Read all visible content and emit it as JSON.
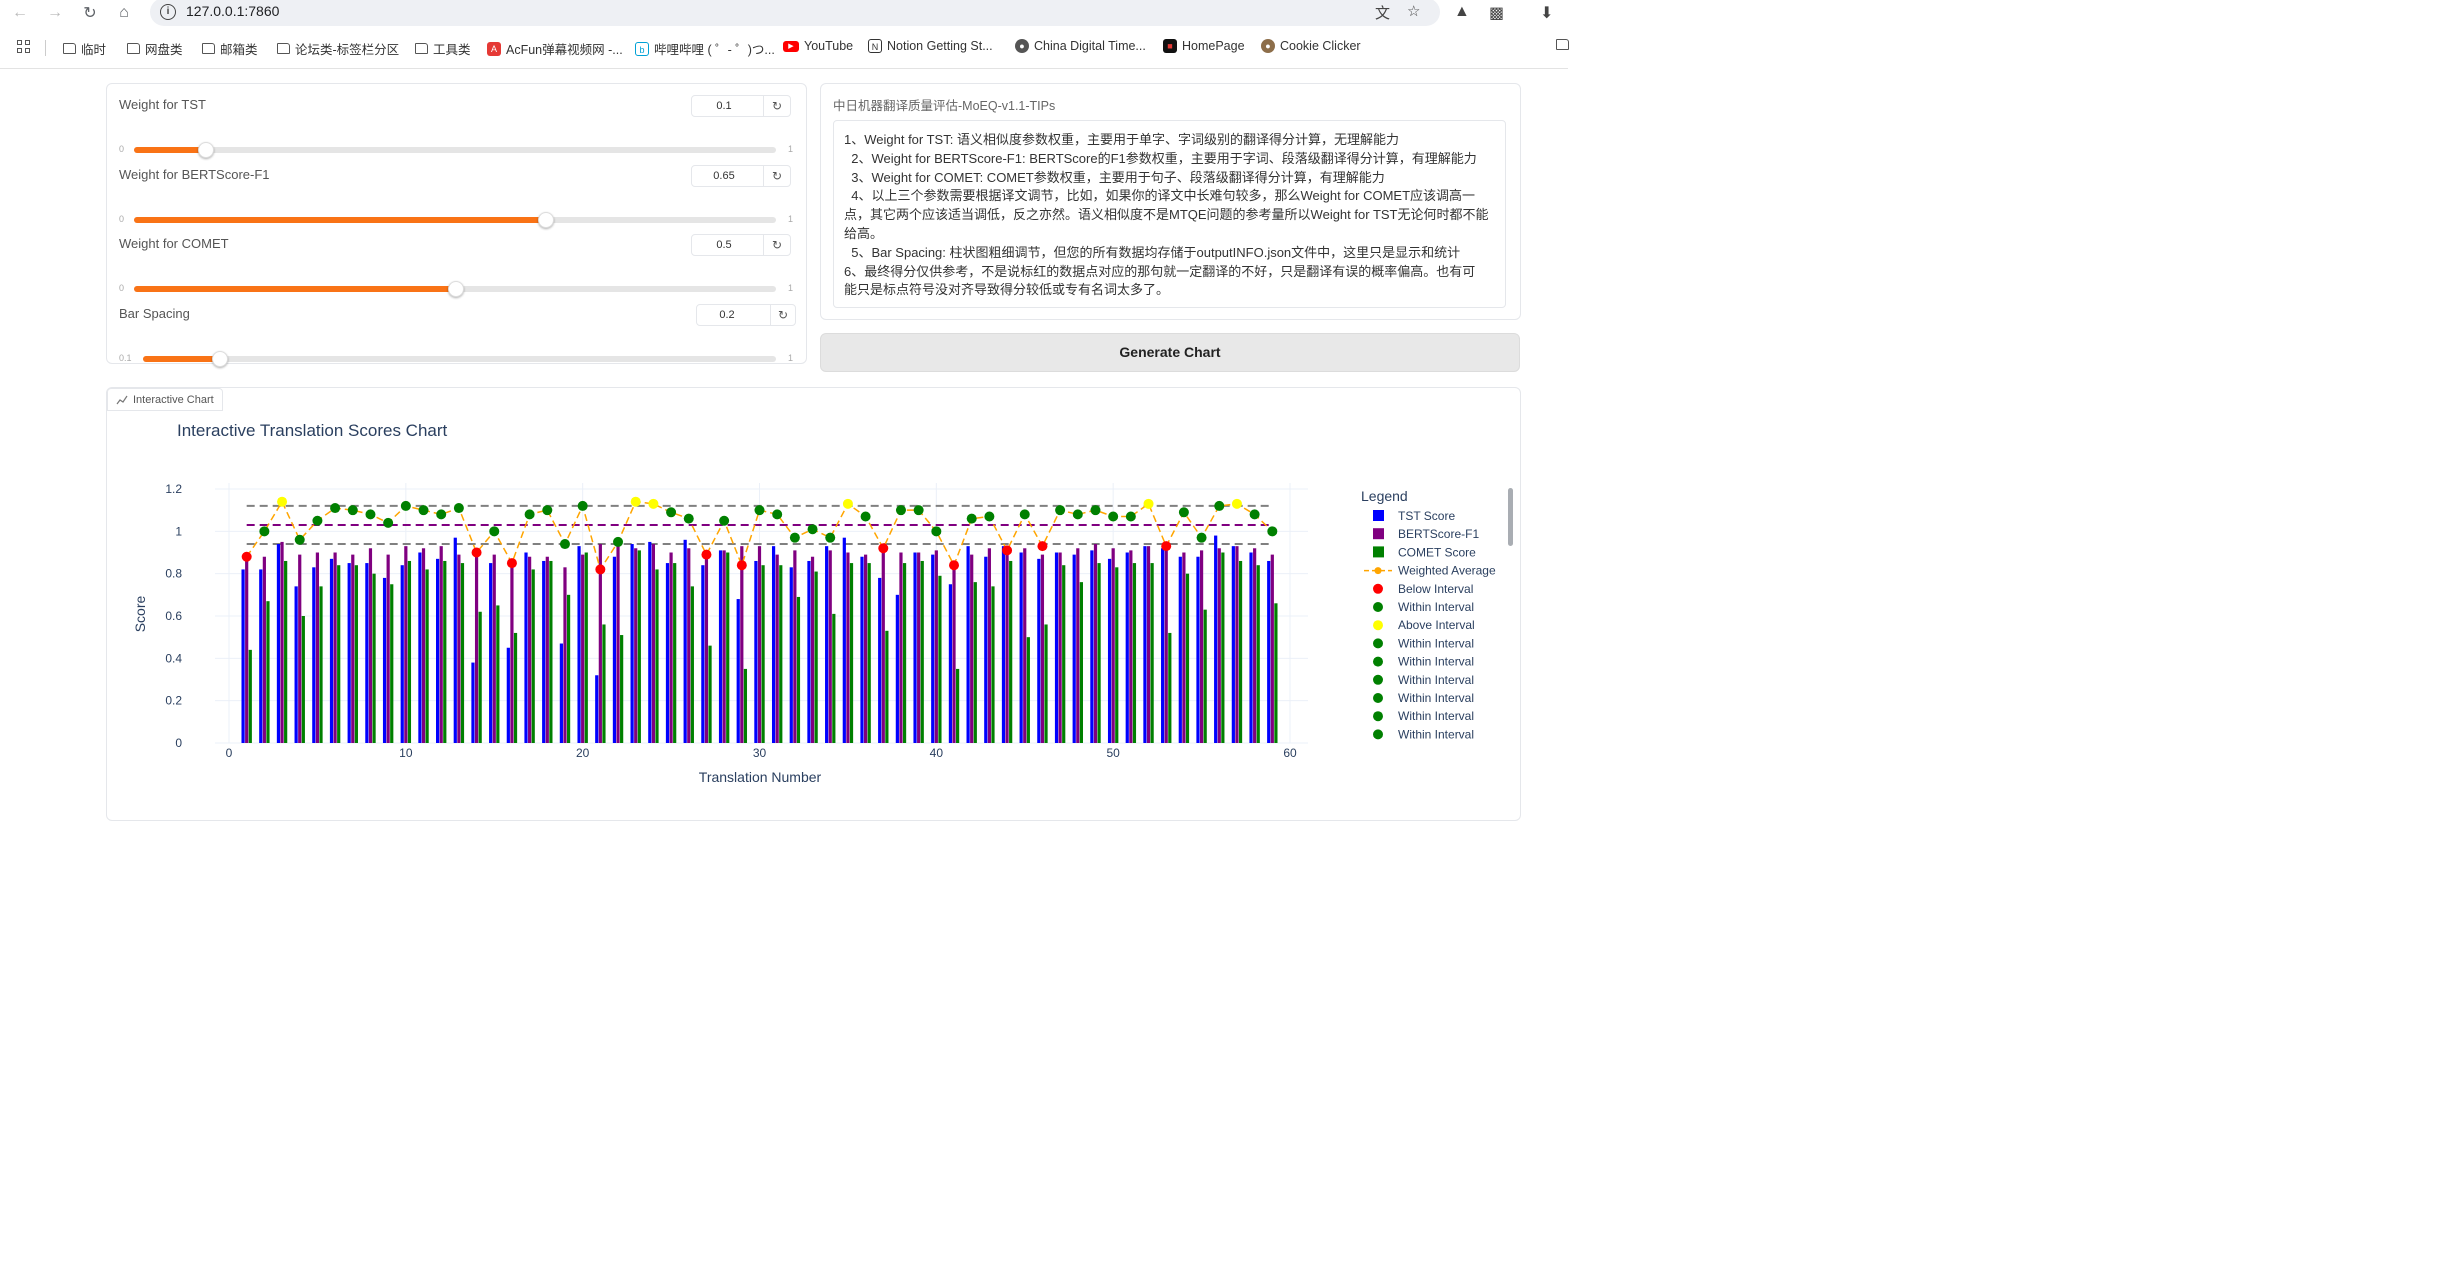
{
  "browser": {
    "url": "127.0.0.1:7860",
    "bookmarks": [
      {
        "label": "临时",
        "icon": "folder-icon"
      },
      {
        "label": "网盘类",
        "icon": "folder-icon"
      },
      {
        "label": "邮箱类",
        "icon": "folder-icon"
      },
      {
        "label": "论坛类-标签栏分区",
        "icon": "folder-icon"
      },
      {
        "label": "工具类",
        "icon": "folder-icon"
      },
      {
        "label": "AcFun弹幕视频网 -...",
        "icon": "acfun-icon"
      },
      {
        "label": "哔哩哔哩 ( ゜- ゜)つ...",
        "icon": "bilibili-icon"
      },
      {
        "label": "YouTube",
        "icon": "youtube-icon"
      },
      {
        "label": "Notion Getting St...",
        "icon": "notion-icon"
      },
      {
        "label": "China Digital Time...",
        "icon": "globe-icon"
      },
      {
        "label": "HomePage",
        "icon": "homepage-icon"
      },
      {
        "label": "Cookie Clicker",
        "icon": "cookie-icon"
      }
    ]
  },
  "sliders": [
    {
      "label": "Weight for TST",
      "value": "0.1",
      "min": "0",
      "max": "1",
      "fraction": 0.1
    },
    {
      "label": "Weight for BERTScore-F1",
      "value": "0.65",
      "min": "0",
      "max": "1",
      "fraction": 0.65
    },
    {
      "label": "Weight for COMET",
      "value": "0.5",
      "min": "0",
      "max": "1",
      "fraction": 0.5
    },
    {
      "label": "Bar Spacing",
      "value": "0.2",
      "min": "0.1",
      "max": "1",
      "fraction": 0.111
    }
  ],
  "tips": {
    "title": "中日机器翻译质量评估-MoEQ-v1.1-TIPs",
    "lines": [
      "1、Weight for TST: 语义相似度参数权重，主要用于单字、字词级别的翻译得分计算，无理解能力",
      "  2、Weight for BERTScore-F1: BERTScore的F1参数权重，主要用于字词、段落级翻译得分计算，有理解能力",
      "  3、Weight for COMET: COMET参数权重，主要用于句子、段落级翻译得分计算，有理解能力",
      "  4、以上三个参数需要根据译文调节，比如，如果你的译文中长难句较多，那么Weight for COMET应该调高一",
      "点，其它两个应该适当调低，反之亦然。语义相似度不是MTQE问题的参考量所以Weight for TST无论何时都不能",
      "给高。",
      "  5、Bar Spacing: 柱状图粗细调节，但您的所有数据均存储于outputINFO.json文件中，这里只是显示和统计",
      "6、最终得分仅供参考，不是说标红的数据点对应的那句就一定翻译的不好，只是翻译有误的概率偏高。也有可",
      "能只是标点符号没对齐导致得分较低或专有名词太多了。"
    ]
  },
  "generate_button": "Generate Chart",
  "chart_tab_label": "Interactive Chart",
  "chart_data": {
    "type": "bar",
    "title": "Interactive Translation Scores Chart",
    "xlabel": "Translation Number",
    "ylabel": "Score",
    "xlim": [
      0,
      60
    ],
    "ylim": [
      0,
      1.2
    ],
    "x_ticks": [
      "0",
      "10",
      "20",
      "30",
      "40",
      "50",
      "60"
    ],
    "y_ticks": [
      "0",
      "0.2",
      "0.4",
      "0.6",
      "0.8",
      "1",
      "1.2"
    ],
    "legend_title": "Legend",
    "legend_position": "right",
    "grid": true,
    "colors": {
      "tst": "#0000ff",
      "bert": "#800080",
      "comet": "#008000",
      "weighted": "#ffa500",
      "below": "#ff0000",
      "within": "#008000",
      "above": "#ffff00",
      "upper_line": "#808080",
      "mid_line": "#800080",
      "lower_line": "#808080"
    },
    "reference_lines": {
      "upper": 1.12,
      "mid": 1.03,
      "lower": 0.94
    },
    "x": [
      1,
      2,
      3,
      4,
      5,
      6,
      7,
      8,
      9,
      10,
      11,
      12,
      13,
      14,
      15,
      16,
      17,
      18,
      19,
      20,
      21,
      22,
      23,
      24,
      25,
      26,
      27,
      28,
      29,
      30,
      31,
      32,
      33,
      34,
      35,
      36,
      37,
      38,
      39,
      40,
      41,
      42,
      43,
      44,
      45,
      46,
      47,
      48,
      49,
      50,
      51,
      52,
      53,
      54,
      55,
      56,
      57,
      58,
      59
    ],
    "series": [
      {
        "name": "TST Score",
        "type": "bar",
        "values": [
          0.82,
          0.82,
          0.94,
          0.74,
          0.83,
          0.87,
          0.85,
          0.85,
          0.78,
          0.84,
          0.9,
          0.87,
          0.97,
          0.38,
          0.85,
          0.45,
          0.9,
          0.86,
          0.47,
          0.93,
          0.32,
          0.88,
          0.94,
          0.95,
          0.85,
          0.96,
          0.84,
          0.91,
          0.68,
          0.86,
          0.93,
          0.83,
          0.86,
          0.93,
          0.97,
          0.88,
          0.78,
          0.7,
          0.9,
          0.89,
          0.75,
          0.93,
          0.88,
          0.93,
          0.9,
          0.87,
          0.9,
          0.89,
          0.91,
          0.87,
          0.9,
          0.93,
          0.92,
          0.88,
          0.88,
          0.98,
          0.93,
          0.9,
          0.86
        ]
      },
      {
        "name": "BERTScore-F1",
        "type": "bar",
        "values": [
          0.86,
          0.88,
          0.95,
          0.89,
          0.9,
          0.9,
          0.89,
          0.92,
          0.89,
          0.93,
          0.92,
          0.93,
          0.89,
          0.9,
          0.89,
          0.87,
          0.88,
          0.88,
          0.83,
          0.89,
          0.94,
          0.94,
          0.92,
          0.94,
          0.9,
          0.92,
          0.89,
          0.91,
          0.93,
          0.93,
          0.89,
          0.91,
          0.88,
          0.91,
          0.9,
          0.89,
          0.92,
          0.9,
          0.9,
          0.91,
          0.85,
          0.89,
          0.92,
          0.91,
          0.92,
          0.89,
          0.9,
          0.92,
          0.94,
          0.92,
          0.91,
          0.93,
          0.91,
          0.9,
          0.91,
          0.92,
          0.93,
          0.92,
          0.89
        ]
      },
      {
        "name": "COMET Score",
        "type": "bar",
        "values": [
          0.44,
          0.67,
          0.86,
          0.6,
          0.74,
          0.84,
          0.84,
          0.8,
          0.75,
          0.86,
          0.82,
          0.86,
          0.85,
          0.62,
          0.65,
          0.52,
          0.82,
          0.86,
          0.7,
          0.9,
          0.56,
          0.51,
          0.91,
          0.82,
          0.85,
          0.74,
          0.46,
          0.9,
          0.35,
          0.84,
          0.84,
          0.69,
          0.81,
          0.61,
          0.85,
          0.85,
          0.53,
          0.85,
          0.86,
          0.79,
          0.35,
          0.76,
          0.74,
          0.86,
          0.5,
          0.56,
          0.84,
          0.76,
          0.85,
          0.83,
          0.85,
          0.85,
          0.52,
          0.8,
          0.63,
          0.9,
          0.86,
          0.84,
          0.66
        ]
      },
      {
        "name": "Weighted Average",
        "type": "line",
        "values": [
          0.88,
          1.0,
          1.14,
          0.96,
          1.05,
          1.11,
          1.1,
          1.08,
          1.04,
          1.12,
          1.1,
          1.08,
          1.11,
          0.9,
          1.0,
          0.85,
          1.08,
          1.1,
          0.94,
          1.12,
          0.82,
          0.95,
          1.14,
          1.13,
          1.09,
          1.06,
          0.89,
          1.05,
          0.84,
          1.1,
          1.08,
          0.97,
          1.01,
          0.97,
          1.13,
          1.07,
          0.92,
          1.1,
          1.1,
          1.0,
          0.84,
          1.06,
          1.07,
          0.91,
          1.08,
          0.93,
          1.1,
          1.08,
          1.1,
          1.07,
          1.07,
          1.13,
          0.93,
          1.09,
          0.97,
          1.12,
          1.13,
          1.08,
          1.0
        ]
      }
    ],
    "legend": [
      "TST Score",
      "BERTScore-F1",
      "COMET Score",
      "Weighted Average",
      "Below Interval",
      "Within Interval",
      "Above Interval",
      "Within Interval",
      "Within Interval",
      "Within Interval",
      "Within Interval",
      "Within Interval",
      "Within Interval"
    ],
    "legend_symbols": [
      "square-blue",
      "square-purple",
      "square-green",
      "line-orange",
      "dot-red",
      "dot-green",
      "dot-yellow",
      "dot-green",
      "dot-green",
      "dot-green",
      "dot-green",
      "dot-green",
      "dot-green"
    ]
  }
}
